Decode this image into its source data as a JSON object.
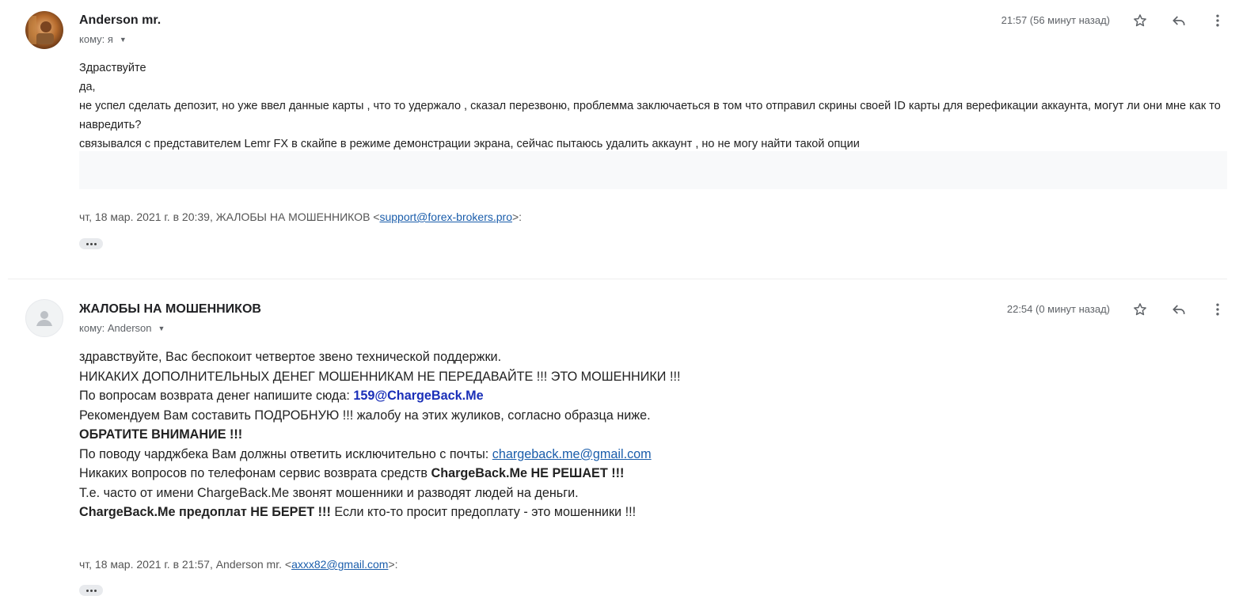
{
  "messages": [
    {
      "sender": "Anderson mr.",
      "to_label": "кому: я",
      "time": "21:57 (56 минут назад)",
      "body_lines": [
        "Здраствуйте",
        "да,",
        "не успел сделать депозит, но уже ввел данные карты , что то удержало , сказал перезвоню, проблемма заключаеться в том что отправил скрины своей ID  карты для верефикации аккаунта, могут ли они мне как то навредить?",
        "связывался с представителем Lemr FX  в скайпе в режиме демонстрации экрана, сейчас пытаюсь удалить аккаунт , но не могу найти такой опции"
      ],
      "quote_prefix": "чт, 18 мар. 2021 г. в 20:39, ЖАЛОБЫ НА МОШЕННИКОВ <",
      "quote_email": "support@forex-brokers.pro",
      "quote_suffix": ">:"
    },
    {
      "sender": "ЖАЛОБЫ НА МОШЕННИКОВ",
      "to_label": "кому: Anderson",
      "time": "22:54 (0 минут назад)",
      "lines": {
        "l1": "здравствуйте, Вас беспокоит четвертое звено технической поддержки.",
        "l2": "НИКАКИХ ДОПОЛНИТЕЛЬНЫХ ДЕНЕГ МОШЕННИКАМ НЕ ПЕРЕДАВАЙТЕ !!! ЭТО МОШЕННИКИ !!!",
        "l3_text": "По вопросам возврата денег напишите сюда: ",
        "l3_email": "159@ChargeBack.Me",
        "l4": "Рекомендуем Вам составить ПОДРОБНУЮ !!! жалобу на этих жуликов, согласно образца ниже.",
        "l5": "ОБРАТИТЕ ВНИМАНИЕ !!!",
        "l6_text": "По поводу чарджбека Вам должны ответить исключительно с почты: ",
        "l6_email": "chargeback.me@gmail.com",
        "l7_text": "Никаких вопросов по телефонам сервис возврата средств ",
        "l7_bold": "ChargeBack.Me НЕ РЕШАЕТ !!!",
        "l8": "Т.е. часто от имени ChargeBack.Me звонят мошенники и разводят людей на деньги.",
        "l9_bold": "ChargeBack.Me предоплат НЕ БЕРЕТ !!!",
        "l9_text": " Если кто-то просит предоплату - это мошенники !!!"
      },
      "quote_prefix": "чт, 18 мар. 2021 г. в 21:57, Anderson mr. <",
      "quote_email": "axxx82@gmail.com",
      "quote_suffix": ">:"
    }
  ],
  "icons": {
    "star": "star-icon",
    "reply": "reply-icon",
    "more": "more-vert-icon",
    "caret": "chevron-down-icon",
    "ellipsis": "show-trimmed-content-icon"
  },
  "colors": {
    "link": "#1a5dab",
    "email_bold": "#1a2fb8",
    "muted": "#5f6368"
  }
}
